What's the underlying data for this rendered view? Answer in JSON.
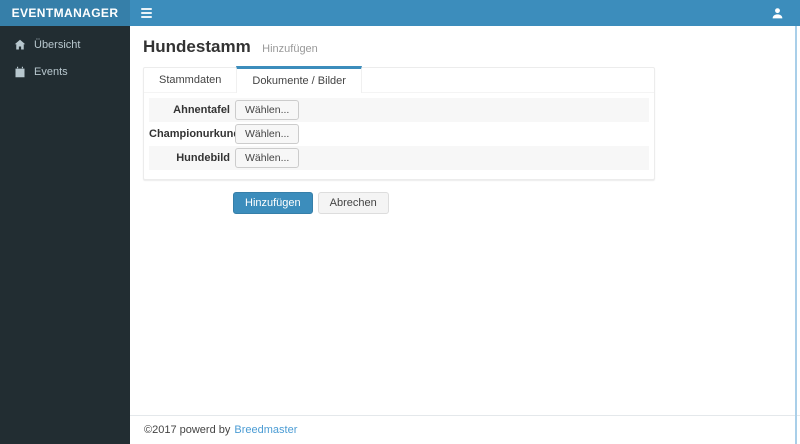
{
  "header": {
    "brand": "EVENTMANAGER",
    "icons": {
      "menu": "hamburger-menu-icon",
      "user": "user-icon"
    }
  },
  "sidebar": {
    "items": [
      {
        "label": "Übersicht",
        "icon": "home-icon"
      },
      {
        "label": "Events",
        "icon": "calendar-icon"
      }
    ]
  },
  "page": {
    "title": "Hundestamm",
    "subtitle": "Hinzufügen"
  },
  "tabs": [
    {
      "label": "Stammdaten",
      "active": false
    },
    {
      "label": "Dokumente / Bilder",
      "active": true
    }
  ],
  "form": {
    "rows": [
      {
        "label": "Ahnentafel",
        "button_label": "Wählen..."
      },
      {
        "label": "Championurkunde",
        "button_label": "Wählen..."
      },
      {
        "label": "Hundebild",
        "button_label": "Wählen..."
      }
    ]
  },
  "actions": {
    "submit_label": "Hinzufügen",
    "cancel_label": "Abrechen"
  },
  "footer": {
    "text": "©2017 powerd by",
    "link_label": "Breedmaster"
  },
  "colors": {
    "navbar": "#3c8dbc",
    "logo_bg": "#367fa9",
    "sidebar_bg": "#222d32",
    "sidebar_text": "#b8c7ce",
    "accent": "#3c8dbc",
    "link": "#4b9cd4",
    "stripe": "#f7f7f7"
  }
}
